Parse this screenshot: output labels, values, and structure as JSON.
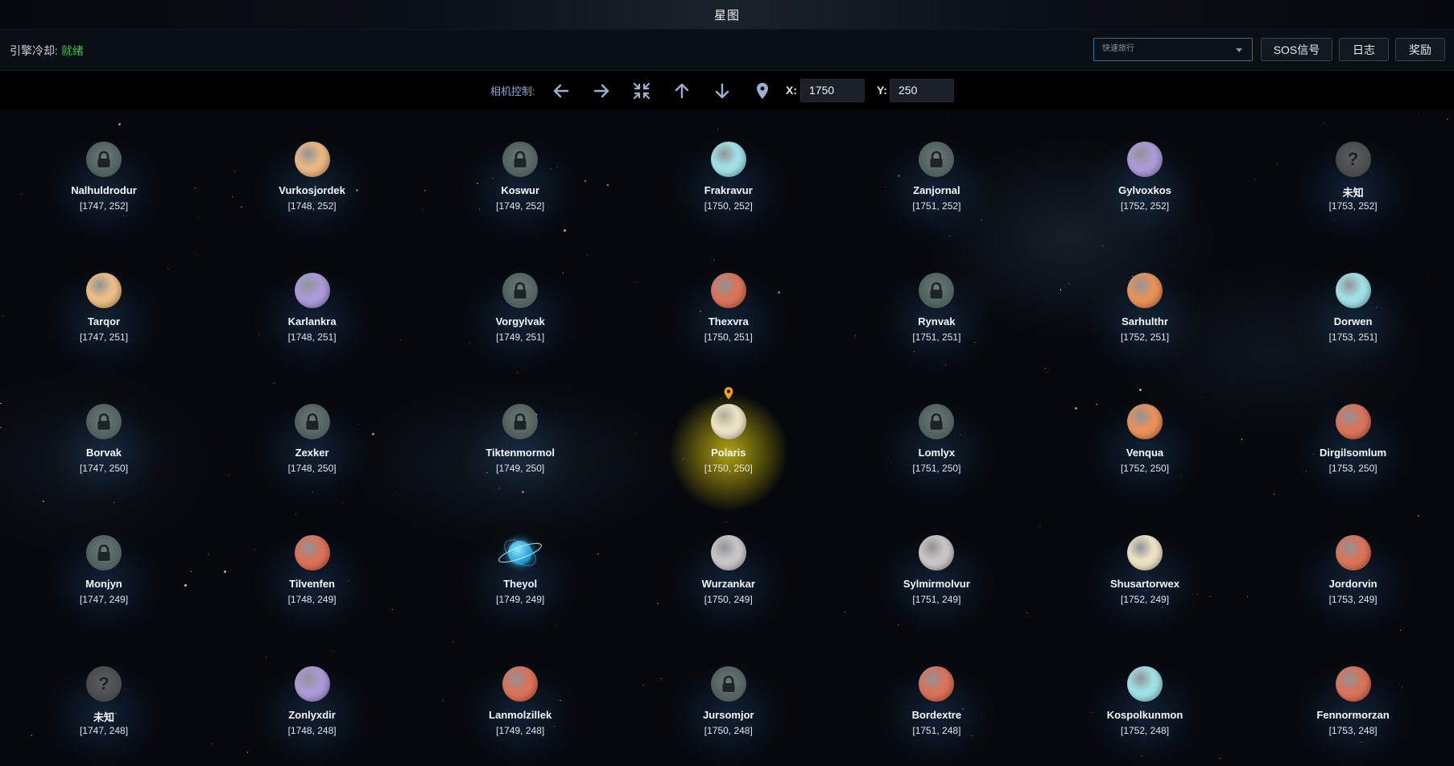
{
  "title": "星图",
  "status": {
    "engine_label": "引擎冷却:",
    "engine_state": "就绪"
  },
  "quick_travel": {
    "placeholder": "快速旅行"
  },
  "buttons": {
    "sos": "SOS信号",
    "log": "日志",
    "rewards": "奖励"
  },
  "camera": {
    "label": "相机控制:",
    "x_label": "X:",
    "x_value": "1750",
    "y_label": "Y:",
    "y_value": "250"
  },
  "colors": {
    "ready": "#45c24a",
    "accent": "#2f6fb1",
    "current_glow": "#cdbd14",
    "pin": "#f0a500"
  },
  "grid": [
    [
      {
        "name": "Nalhuldrodur",
        "coords": "[1747, 252]",
        "kind": "locked"
      },
      {
        "name": "Vurkosjordek",
        "coords": "[1748, 252]",
        "kind": "planet",
        "color": "#eab681"
      },
      {
        "name": "Koswur",
        "coords": "[1749, 252]",
        "kind": "locked"
      },
      {
        "name": "Frakravur",
        "coords": "[1750, 252]",
        "kind": "planet",
        "color": "#9fe0e6"
      },
      {
        "name": "Zanjornal",
        "coords": "[1751, 252]",
        "kind": "locked"
      },
      {
        "name": "Gylvoxkos",
        "coords": "[1752, 252]",
        "kind": "planet",
        "color": "#ab9ad6"
      },
      {
        "name": "未知",
        "coords": "[1753, 252]",
        "kind": "unknown"
      }
    ],
    [
      {
        "name": "Tarqor",
        "coords": "[1747, 251]",
        "kind": "planet",
        "color": "#ebbd87"
      },
      {
        "name": "Karlankra",
        "coords": "[1748, 251]",
        "kind": "planet",
        "color": "#ab9ad6"
      },
      {
        "name": "Vorgylvak",
        "coords": "[1749, 251]",
        "kind": "locked"
      },
      {
        "name": "Thexvra",
        "coords": "[1750, 251]",
        "kind": "planet",
        "color": "#d9735a"
      },
      {
        "name": "Rynvak",
        "coords": "[1751, 251]",
        "kind": "locked"
      },
      {
        "name": "Sarhulthr",
        "coords": "[1752, 251]",
        "kind": "planet",
        "color": "#e8915a"
      },
      {
        "name": "Dorwen",
        "coords": "[1753, 251]",
        "kind": "planet",
        "color": "#9fe0e6"
      }
    ],
    [
      {
        "name": "Borvak",
        "coords": "[1747, 250]",
        "kind": "locked"
      },
      {
        "name": "Zexker",
        "coords": "[1748, 250]",
        "kind": "locked"
      },
      {
        "name": "Tiktenmormol",
        "coords": "[1749, 250]",
        "kind": "locked"
      },
      {
        "name": "Polaris",
        "coords": "[1750, 250]",
        "kind": "planet",
        "color": "#ebe2c4",
        "current": true
      },
      {
        "name": "Lomlyx",
        "coords": "[1751, 250]",
        "kind": "locked"
      },
      {
        "name": "Venqua",
        "coords": "[1752, 250]",
        "kind": "planet",
        "color": "#e8915a"
      },
      {
        "name": "Dirgilsomlum",
        "coords": "[1753, 250]",
        "kind": "planet",
        "color": "#d9735a"
      }
    ],
    [
      {
        "name": "Monjyn",
        "coords": "[1747, 249]",
        "kind": "locked"
      },
      {
        "name": "Tilvenfen",
        "coords": "[1748, 249]",
        "kind": "planet",
        "color": "#d9735a"
      },
      {
        "name": "Theyol",
        "coords": "[1749, 249]",
        "kind": "ringed",
        "color": "#3fb3e0"
      },
      {
        "name": "Wurzankar",
        "coords": "[1750, 249]",
        "kind": "planet",
        "color": "#c9c5c4"
      },
      {
        "name": "Sylmirmolvur",
        "coords": "[1751, 249]",
        "kind": "planet",
        "color": "#c9c5c4"
      },
      {
        "name": "Shusartorwex",
        "coords": "[1752, 249]",
        "kind": "planet",
        "color": "#ebe2c4"
      },
      {
        "name": "Jordorvin",
        "coords": "[1753, 249]",
        "kind": "planet",
        "color": "#d9735a"
      }
    ],
    [
      {
        "name": "未知",
        "coords": "[1747, 248]",
        "kind": "unknown"
      },
      {
        "name": "Zonlyxdir",
        "coords": "[1748, 248]",
        "kind": "planet",
        "color": "#ab9ad6"
      },
      {
        "name": "Lanmolzillek",
        "coords": "[1749, 248]",
        "kind": "planet",
        "color": "#d9735a"
      },
      {
        "name": "Jursomjor",
        "coords": "[1750, 248]",
        "kind": "locked"
      },
      {
        "name": "Bordextre",
        "coords": "[1751, 248]",
        "kind": "planet",
        "color": "#d9735a"
      },
      {
        "name": "Kospolkunmon",
        "coords": "[1752, 248]",
        "kind": "planet",
        "color": "#9fe0e6"
      },
      {
        "name": "Fennormorzan",
        "coords": "[1753, 248]",
        "kind": "planet",
        "color": "#d9735a"
      }
    ]
  ]
}
